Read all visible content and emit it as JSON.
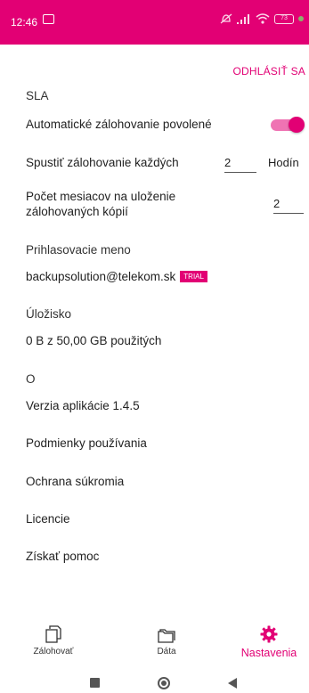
{
  "status_bar": {
    "time": "12:46",
    "battery": "73",
    "notification_icon": "screen-icon",
    "icons": [
      "mute-icon",
      "signal-icon",
      "wifi-icon",
      "battery-icon"
    ]
  },
  "actions": {
    "logout": "ODHLÁSIŤ SA"
  },
  "sla": {
    "title": "SLA",
    "auto_backup_label": "Automatické zálohovanie povolené",
    "auto_backup_enabled": true,
    "run_every_label": "Spustiť zálohovanie každých",
    "run_every_value": "2",
    "run_every_unit": "Hodín",
    "months_label_line1": "Počet mesiacov na uloženie",
    "months_label_line2": "zálohovaných kópií",
    "months_value": "2"
  },
  "login": {
    "title": "Prihlasovacie meno",
    "username": "backupsolution@telekom.sk",
    "badge": "TRIAL"
  },
  "storage": {
    "title": "Úložisko",
    "usage": "0 B z 50,00 GB použitých"
  },
  "about": {
    "title": "O",
    "version": "Verzia aplikácie 1.4.5",
    "terms": "Podmienky používania",
    "privacy": "Ochrana súkromia",
    "licenses": "Licencie",
    "help": "Získať pomoc"
  },
  "bottom_nav": {
    "items": [
      {
        "label": "Zálohovať",
        "icon": "backup-icon"
      },
      {
        "label": "Dáta",
        "icon": "folder-icon"
      },
      {
        "label": "Nastavenia",
        "icon": "gear-icon",
        "active": true
      }
    ]
  },
  "colors": {
    "accent": "#e20074",
    "text": "#1f1f1f"
  }
}
